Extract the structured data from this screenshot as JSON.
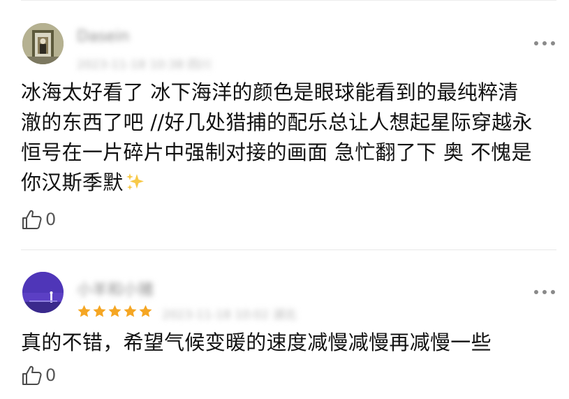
{
  "comments": [
    {
      "username": "Dasein",
      "timestamp": "2023-11-18 10:38 四川",
      "text_lines": [
        "冰海太好看了 冰下海洋的颜色是眼球能看到的最纯粹清",
        "澈的东西了吧 //好几处猎捕的配乐总让人想起星际穿越永",
        "恒号在一片碎片中强制对接的画面 急忙翻了下  奥 不愧是",
        "你汉斯季默"
      ],
      "emoji": "sparkles-icon",
      "likes": "0"
    },
    {
      "username": "小羊和小猪",
      "rating": 5,
      "timestamp": "2023-11-18 10:02 湖北",
      "text_lines": [
        "真的不错，希望气候变暖的速度减慢减慢再减慢一些"
      ],
      "likes": "0"
    }
  ],
  "colors": {
    "star": "#f5a623",
    "avatar_2": "#5b3fc4",
    "text": "#121212",
    "meta": "#b9b9b9"
  }
}
